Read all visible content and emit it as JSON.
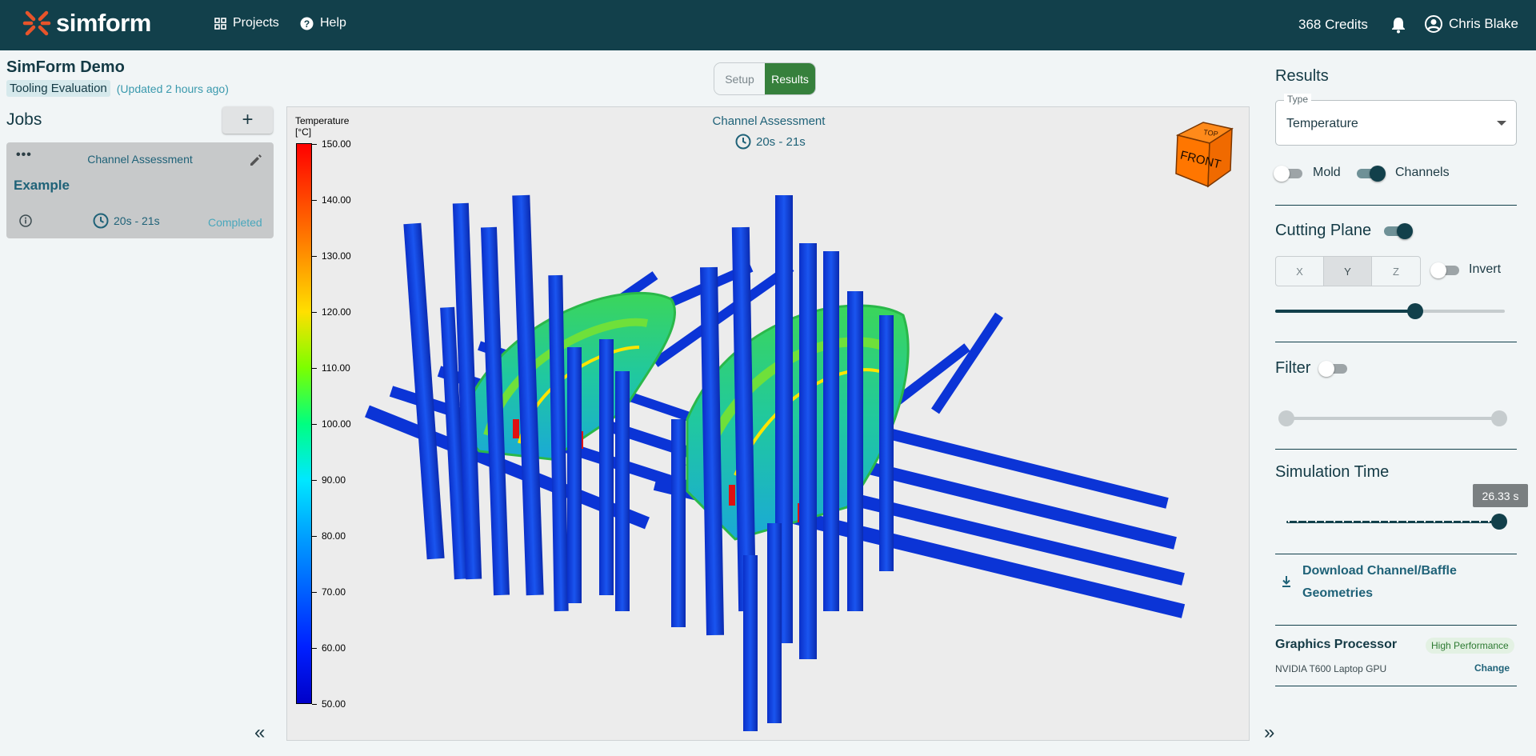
{
  "app": {
    "name": "simform"
  },
  "nav": {
    "projects": "Projects",
    "help": "Help"
  },
  "account": {
    "credits": "368 Credits",
    "user": "Chris Blake"
  },
  "project": {
    "title": "SimForm Demo",
    "chip": "Tooling Evaluation",
    "updated": "(Updated 2 hours ago)"
  },
  "jobs": {
    "title": "Jobs",
    "add_label": "+",
    "items": [
      {
        "name": "Channel Assessment",
        "label": "Example",
        "time": "20s - 21s",
        "status": "Completed"
      }
    ]
  },
  "view_toggle": {
    "setup": "Setup",
    "results": "Results",
    "active": "Results"
  },
  "viewer": {
    "title": "Channel Assessment",
    "time": "20s - 21s",
    "legend_title_1": "Temperature",
    "legend_title_2": "[°C]",
    "legend_ticks": [
      "150.00",
      "140.00",
      "130.00",
      "120.00",
      "110.00",
      "100.00",
      "90.00",
      "80.00",
      "70.00",
      "60.00",
      "50.00"
    ],
    "cube_top": "TOP",
    "cube_front": "FRONT"
  },
  "results_panel": {
    "title": "Results",
    "type_label": "Type",
    "type_value": "Temperature",
    "mold_label": "Mold",
    "mold_on": false,
    "channels_label": "Channels",
    "channels_on": true,
    "cutting_plane_title": "Cutting Plane",
    "cutting_plane_on": true,
    "axes": [
      "X",
      "Y",
      "Z"
    ],
    "selected_axis": "Y",
    "invert_label": "Invert",
    "invert_on": false,
    "cutting_position_fraction": 0.61,
    "filter_title": "Filter",
    "filter_on": false,
    "sim_time_title": "Simulation Time",
    "sim_time_value": "26.33 s",
    "download_label": "Download Channel/Baffle Geometries",
    "gpu_title": "Graphics Processor",
    "gpu_badge": "High Performance",
    "gpu_name": "NVIDIA T600 Laptop GPU",
    "gpu_change": "Change"
  },
  "colors": {
    "topbar": "#12404b",
    "accent": "#36803c",
    "logo": "#e8542a",
    "link": "#1f6278"
  }
}
